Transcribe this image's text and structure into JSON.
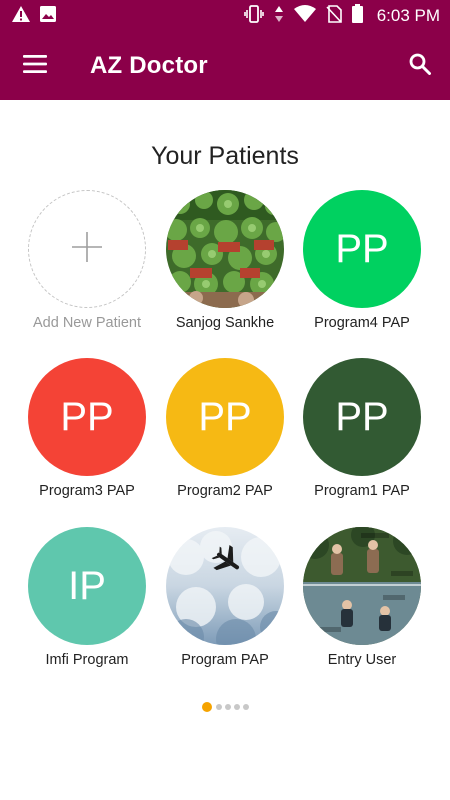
{
  "status_bar": {
    "time": "6:03 PM",
    "left_icons": [
      "warning-icon",
      "image-icon"
    ],
    "right_icons": [
      "vibrate-icon",
      "data-arrows-icon",
      "wifi-icon",
      "no-sim-icon",
      "battery-icon"
    ]
  },
  "app_bar": {
    "title": "AZ Doctor",
    "menu_icon": "hamburger-menu-icon",
    "search_icon": "search-icon",
    "color": "#8b0049"
  },
  "section_title": "Your Patients",
  "patients": [
    {
      "label": "Add New Patient",
      "type": "add"
    },
    {
      "label": "Sanjog Sankhe",
      "type": "photo",
      "photo": "succulent-plants"
    },
    {
      "label": "Program4 PAP",
      "type": "initials",
      "initials": "PP",
      "color": "#00d160"
    },
    {
      "label": "Program3 PAP",
      "type": "initials",
      "initials": "PP",
      "color": "#f44336"
    },
    {
      "label": "Program2 PAP",
      "type": "initials",
      "initials": "PP",
      "color": "#f6b914"
    },
    {
      "label": "Program1 PAP",
      "type": "initials",
      "initials": "PP",
      "color": "#325a33"
    },
    {
      "label": "Imfi Program",
      "type": "initials",
      "initials": "IP",
      "color": "#5fc7ad"
    },
    {
      "label": "Program PAP",
      "type": "photo",
      "photo": "airplane-sky"
    },
    {
      "label": "Entry User",
      "type": "photo",
      "photo": "people-river-meme"
    }
  ],
  "pager": {
    "pages": 5,
    "current": 1,
    "active_color": "#f5a300"
  }
}
